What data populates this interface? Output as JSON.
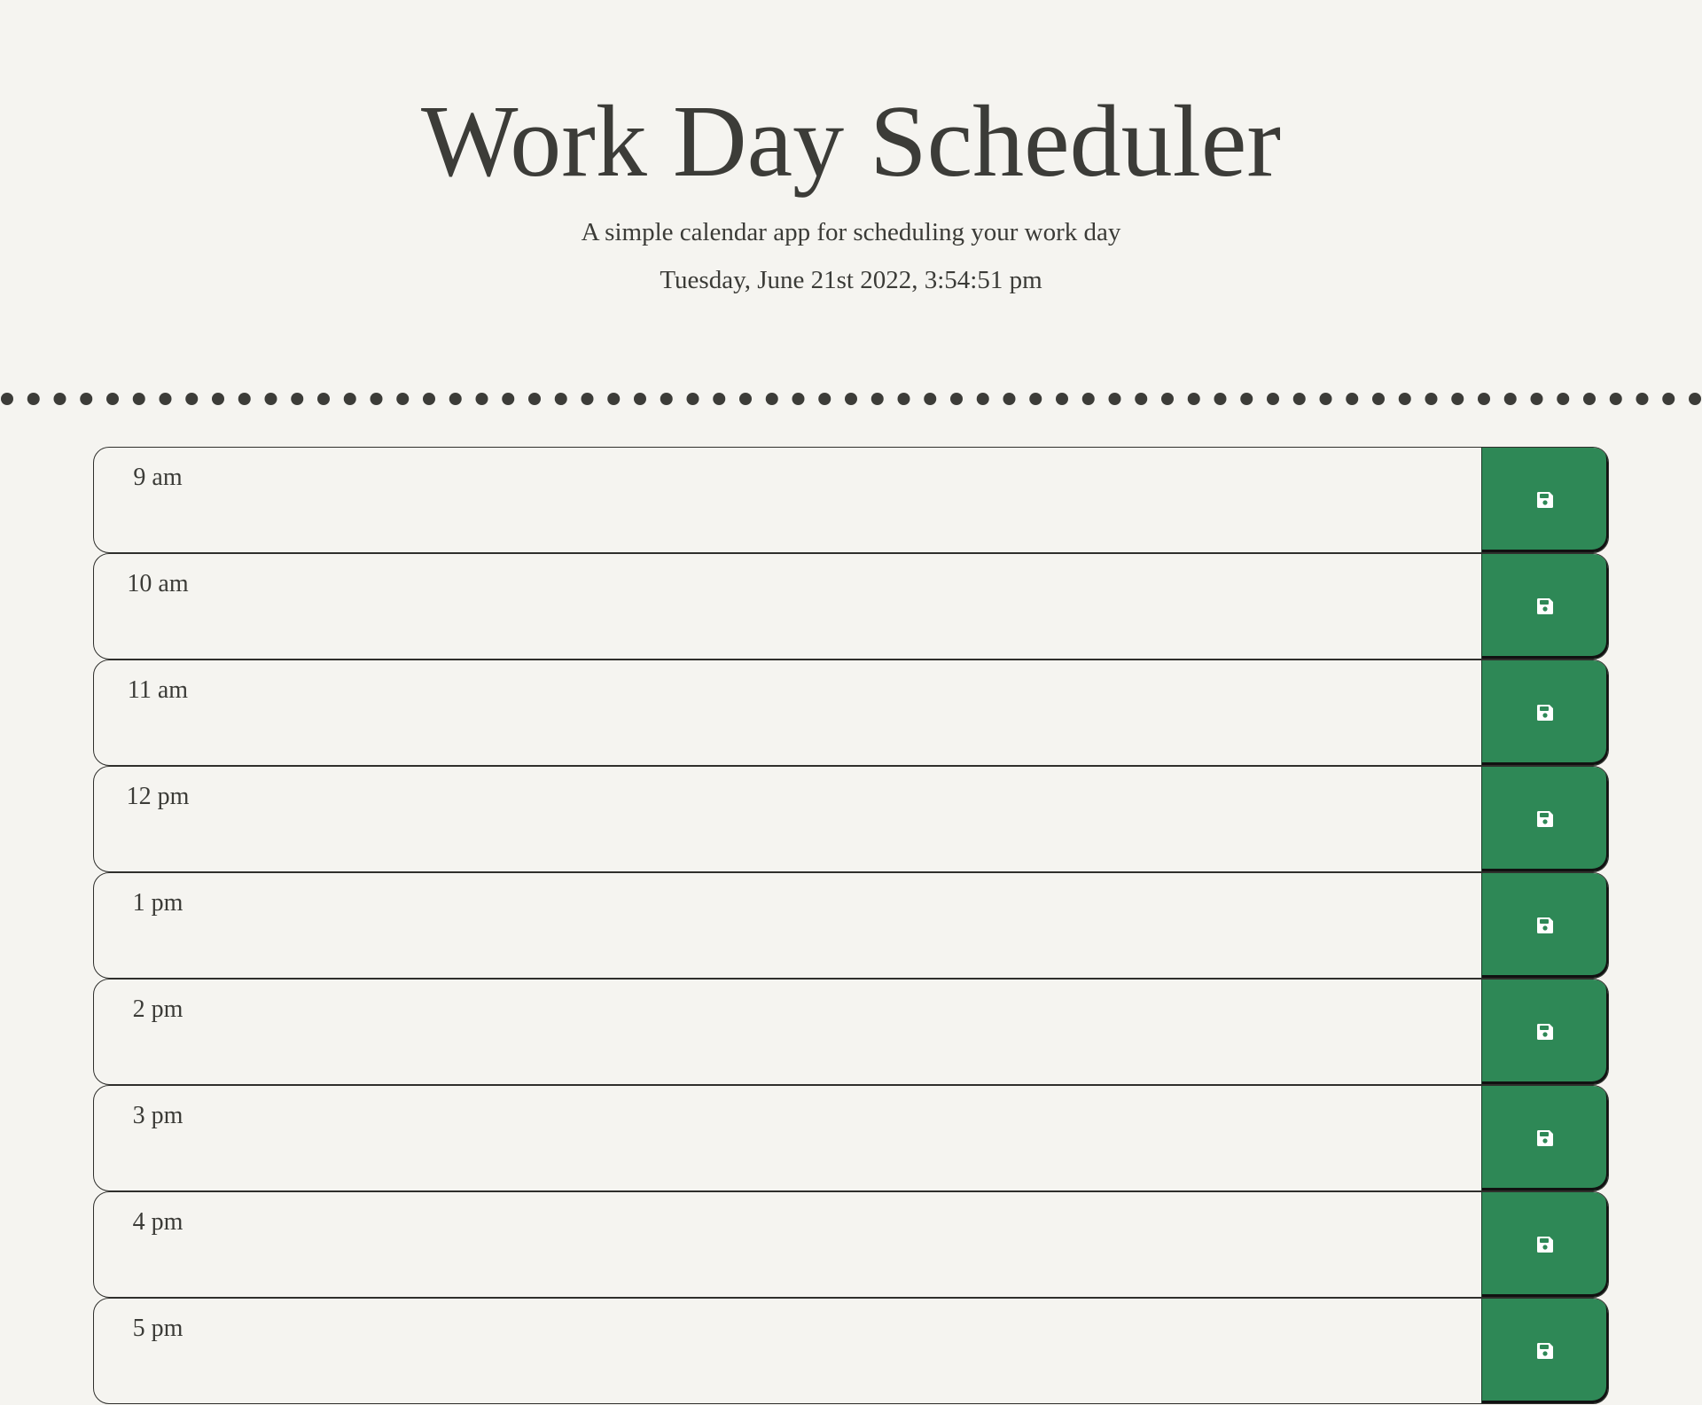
{
  "header": {
    "title": "Work Day Scheduler",
    "subtitle": "A simple calendar app for scheduling your work day",
    "current_day": "Tuesday, June 21st 2022, 3:54:51 pm"
  },
  "colors": {
    "background": "#f5f4f0",
    "save_button": "#2e8856",
    "text": "#3b3b37",
    "dots": "#3c3c38"
  },
  "time_blocks": [
    {
      "hour": "9 am",
      "description": ""
    },
    {
      "hour": "10 am",
      "description": ""
    },
    {
      "hour": "11 am",
      "description": ""
    },
    {
      "hour": "12 pm",
      "description": ""
    },
    {
      "hour": "1 pm",
      "description": ""
    },
    {
      "hour": "2 pm",
      "description": ""
    },
    {
      "hour": "3 pm",
      "description": ""
    },
    {
      "hour": "4 pm",
      "description": ""
    },
    {
      "hour": "5 pm",
      "description": ""
    }
  ],
  "icons": {
    "save": "floppy-disk-icon"
  }
}
